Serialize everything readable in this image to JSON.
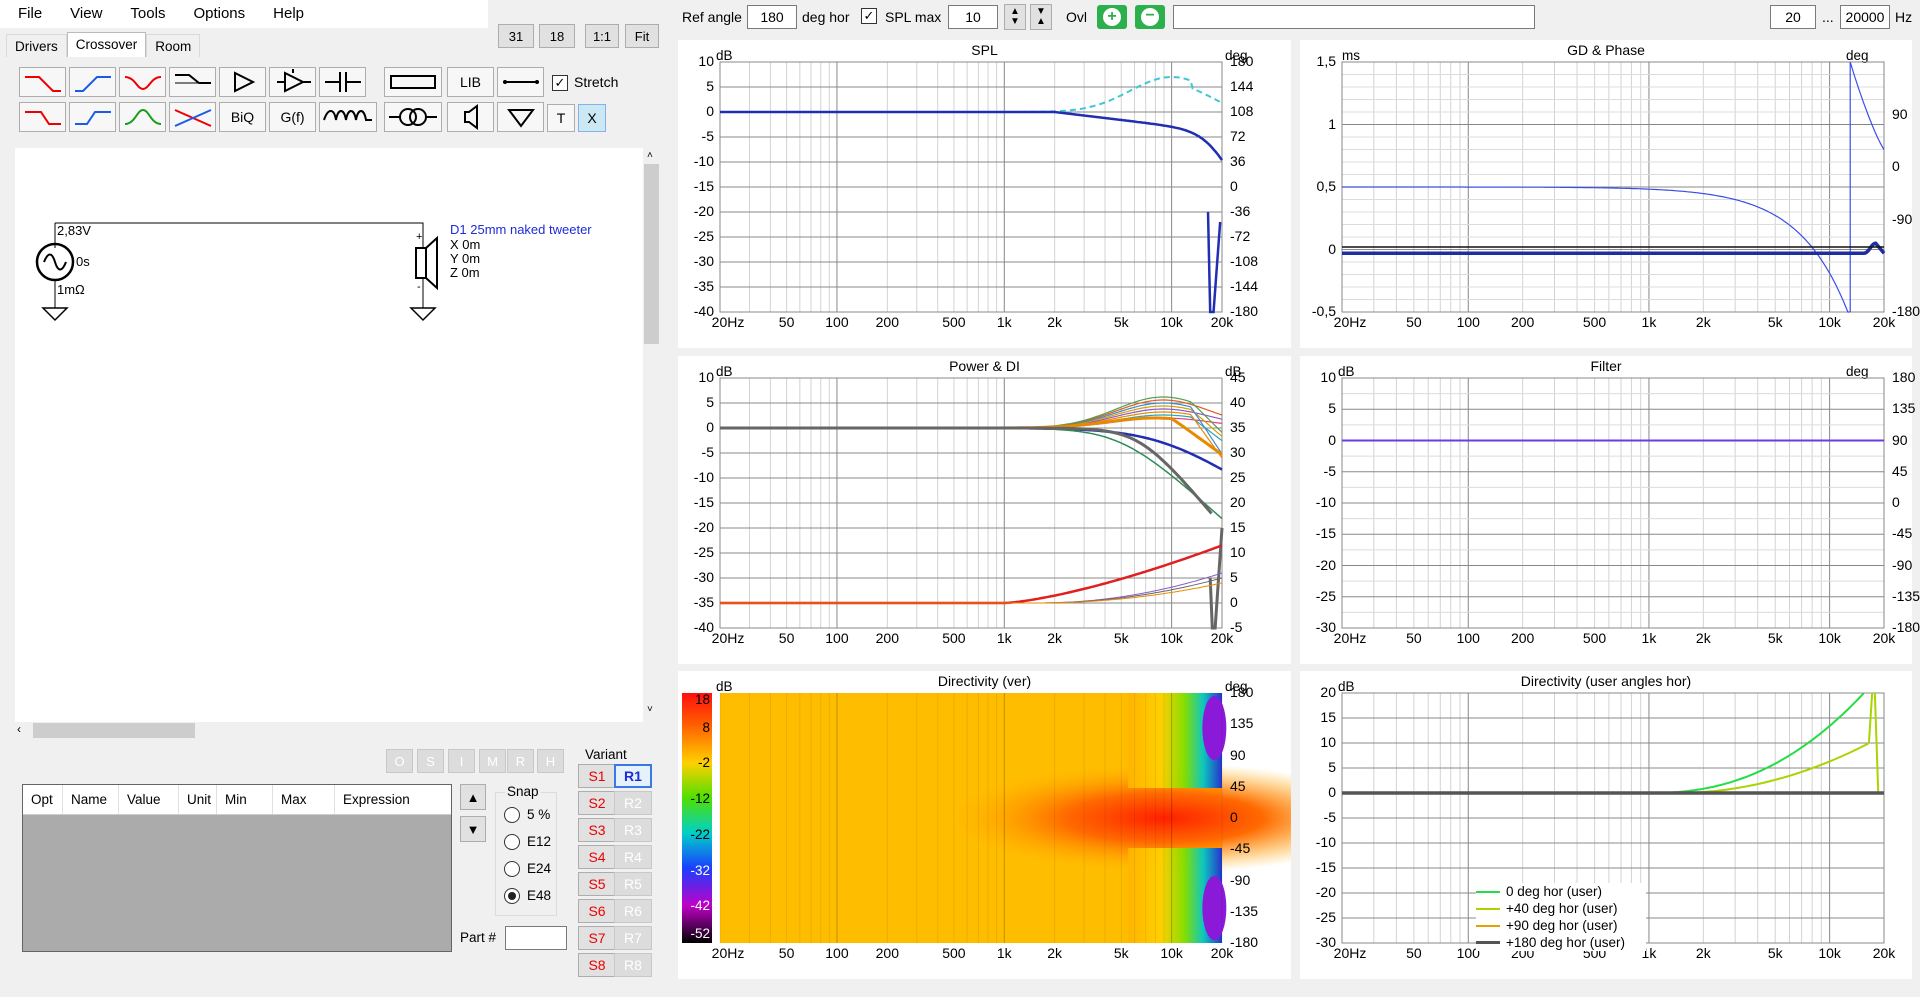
{
  "menu": [
    "File",
    "View",
    "Tools",
    "Options",
    "Help"
  ],
  "zoom_buttons": [
    "31",
    "18",
    "1:1",
    "Fit"
  ],
  "tabs": [
    "Drivers",
    "Crossover",
    "Room"
  ],
  "toolbar": {
    "lib": "LIB",
    "biq": "BiQ",
    "gf": "G(f)",
    "t": "T",
    "x": "X",
    "stretch_label": "Stretch",
    "stretch_checked": true
  },
  "schematic": {
    "voltage": "2,83V",
    "delay": "0s",
    "resistance": "1mΩ",
    "driver_name": "D1 25mm naked tweeter",
    "x": "X 0m",
    "y": "Y 0m",
    "z": "Z 0m"
  },
  "status_buttons": [
    "O",
    "S",
    "I",
    "M",
    "R",
    "H"
  ],
  "table": {
    "columns": [
      "Opt",
      "Name",
      "Value",
      "Unit",
      "Min",
      "Max",
      "Expression"
    ]
  },
  "snap": {
    "label": "Snap",
    "options": [
      "5 %",
      "E12",
      "E24",
      "E48"
    ],
    "selected": "E48"
  },
  "part_label": "Part #",
  "variant": {
    "label": "Variant",
    "s": [
      "S1",
      "S2",
      "S3",
      "S4",
      "S5",
      "S6",
      "S7",
      "S8"
    ],
    "r": [
      "R1",
      "R2",
      "R3",
      "R4",
      "R5",
      "R6",
      "R7",
      "R8"
    ],
    "active_r": "R1"
  },
  "topbar": {
    "ref_angle_label": "Ref angle",
    "ref_angle": "180",
    "deg_hor": "deg hor",
    "spl_max_label": "SPL max",
    "spl_max_checked": true,
    "spl_max": "10",
    "ovl_label": "Ovl",
    "freq_min": "20",
    "ellipsis": "...",
    "freq_max": "20000",
    "hz": "Hz"
  },
  "x_ticks": [
    "20Hz",
    "50",
    "100",
    "200",
    "500",
    "1k",
    "2k",
    "5k",
    "10k",
    "20k"
  ],
  "panels": {
    "spl": {
      "title": "SPL",
      "unit_l": "dB",
      "unit_r": "deg",
      "y_l": [
        "10",
        "5",
        "0",
        "-5",
        "-10",
        "-15",
        "-20",
        "-25",
        "-30",
        "-35",
        "-40"
      ],
      "y_r": [
        "180",
        "144",
        "108",
        "72",
        "36",
        "0",
        "-36",
        "-72",
        "-108",
        "-144",
        "-180"
      ]
    },
    "gd": {
      "title": "GD & Phase",
      "unit_l": "ms",
      "unit_r": "deg",
      "y_l": [
        "1,5",
        "1",
        "0,5",
        "0",
        "-0,5"
      ],
      "y_r": [
        "90",
        "0",
        "-90",
        "-180"
      ]
    },
    "power": {
      "title": "Power & DI",
      "unit_l": "dB",
      "unit_r": "dB",
      "y_l": [
        "10",
        "5",
        "0",
        "-5",
        "-10",
        "-15",
        "-20",
        "-25",
        "-30",
        "-35",
        "-40"
      ],
      "y_r": [
        "45",
        "40",
        "35",
        "30",
        "25",
        "20",
        "15",
        "10",
        "5",
        "0",
        "-5"
      ]
    },
    "filter": {
      "title": "Filter",
      "unit_l": "dB",
      "unit_r": "deg",
      "y_l": [
        "10",
        "5",
        "0",
        "-5",
        "-10",
        "-15",
        "-20",
        "-25",
        "-30"
      ],
      "y_r": [
        "180",
        "135",
        "90",
        "45",
        "0",
        "-45",
        "-90",
        "-135",
        "-180"
      ]
    },
    "dirver": {
      "title": "Directivity (ver)",
      "unit_l": "dB",
      "unit_r": "deg",
      "scale": [
        "18",
        "8",
        "-2",
        "-12",
        "-22",
        "-32",
        "-42",
        "-52"
      ],
      "y_r": [
        "180",
        "135",
        "90",
        "45",
        "0",
        "-45",
        "-90",
        "-135",
        "-180"
      ]
    },
    "dirhor": {
      "title": "Directivity (user angles hor)",
      "unit_l": "dB",
      "y_l": [
        "20",
        "15",
        "10",
        "5",
        "0",
        "-5",
        "-10",
        "-15",
        "-20",
        "-25",
        "-30"
      ],
      "legend": [
        {
          "label": "0 deg hor (user)",
          "color": "#22dd44"
        },
        {
          "label": "+40 deg hor (user)",
          "color": "#aad400"
        },
        {
          "label": "+90 deg hor (user)",
          "color": "#e8a000"
        },
        {
          "label": "+180 deg hor (user)",
          "color": "#555555"
        }
      ]
    }
  }
}
